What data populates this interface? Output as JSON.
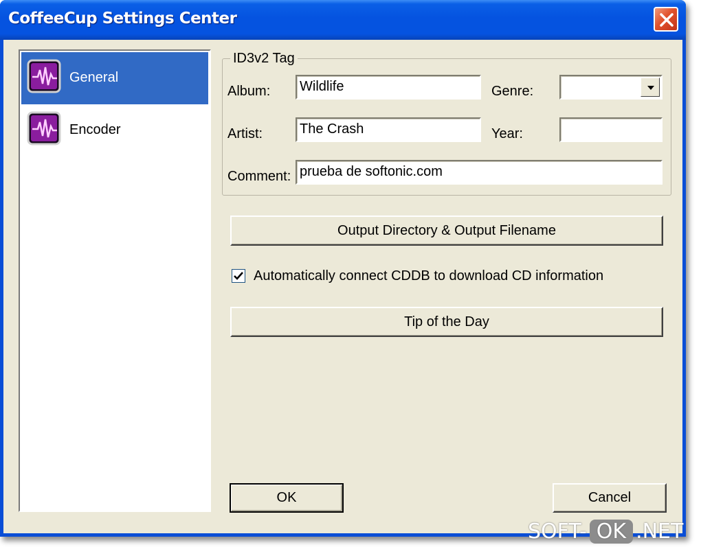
{
  "window": {
    "title": "CoffeeCup Settings Center"
  },
  "sidebar": {
    "items": [
      {
        "label": "General",
        "icon": "audio-waveform-icon",
        "selected": true
      },
      {
        "label": "Encoder",
        "icon": "audio-waveform-icon",
        "selected": false
      }
    ]
  },
  "id3": {
    "group_label": "ID3v2 Tag",
    "album_label": "Album:",
    "album_value": "Wildlife",
    "genre_label": "Genre:",
    "genre_value": "",
    "artist_label": "Artist:",
    "artist_value": "The Crash",
    "year_label": "Year:",
    "year_value": "",
    "comment_label": "Comment:",
    "comment_value": "prueba de softonic.com"
  },
  "actions": {
    "output_button": "Output Directory & Output Filename",
    "cddb_label": "Automatically connect CDDB to download CD information",
    "cddb_checked": true,
    "tip_button": "Tip of the Day",
    "ok_button": "OK",
    "cancel_button": "Cancel"
  },
  "watermark": {
    "part1": "SOFT-",
    "part2": "OK",
    "part3": ".NET"
  },
  "colors": {
    "titlebar": "#0553e0",
    "selection": "#316ac5",
    "dialog_bg": "#ece9d8",
    "close_button": "#e1522c"
  }
}
